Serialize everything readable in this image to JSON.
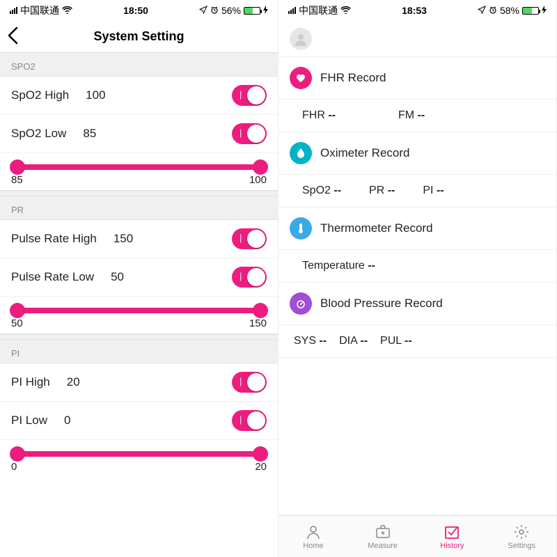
{
  "left": {
    "status": {
      "carrier": "中国联通",
      "time": "18:50",
      "battery_text": "56%",
      "battery_pct": 56
    },
    "nav_title": "System Setting",
    "spo2": {
      "header": "SPO2",
      "high_label": "SpO2 High",
      "high_value": "100",
      "low_label": "SpO2 Low",
      "low_value": "85",
      "range_min": "85",
      "range_max": "100"
    },
    "pr": {
      "header": "PR",
      "high_label": "Pulse Rate High",
      "high_value": "150",
      "low_label": "Pulse Rate Low",
      "low_value": "50",
      "range_min": "50",
      "range_max": "150"
    },
    "pi": {
      "header": "PI",
      "high_label": "PI High",
      "high_value": "20",
      "low_label": "PI Low",
      "low_value": "0",
      "range_min": "0",
      "range_max": "20"
    }
  },
  "right": {
    "status": {
      "carrier": "中国联通",
      "time": "18:53",
      "battery_text": "58%",
      "battery_pct": 58
    },
    "records": {
      "fhr": {
        "title": "FHR Record",
        "fhr_label": "FHR",
        "fhr_val": "--",
        "fm_label": "FM",
        "fm_val": "--"
      },
      "oxi": {
        "title": "Oximeter Record",
        "spo2_label": "SpO2",
        "spo2_val": "--",
        "pr_label": "PR",
        "pr_val": "--",
        "pi_label": "PI",
        "pi_val": "--"
      },
      "therm": {
        "title": "Thermometer Record",
        "temp_label": "Temperature",
        "temp_val": "--"
      },
      "bp": {
        "title": "Blood Pressure Record",
        "sys_label": "SYS",
        "sys_val": "--",
        "dia_label": "DIA",
        "dia_val": "--",
        "pul_label": "PUL",
        "pul_val": "--"
      }
    },
    "tabs": {
      "home": "Home",
      "measure": "Measure",
      "history": "History",
      "settings": "Settings"
    }
  }
}
